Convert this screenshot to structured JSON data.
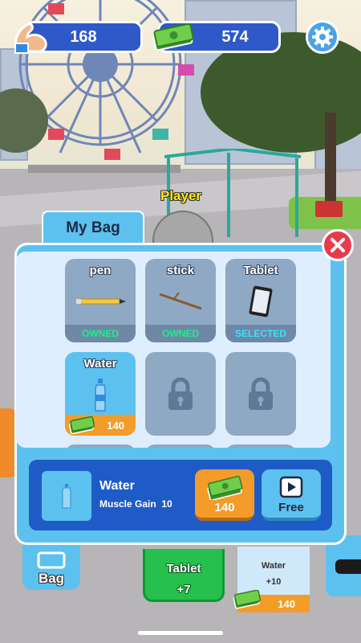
{
  "hud": {
    "strength_value": "168",
    "cash_value": "574",
    "strength_icon": "flexed-arm-icon",
    "cash_icon": "cash-stack-icon",
    "settings_icon": "gear-icon"
  },
  "player": {
    "name": "Player"
  },
  "bag": {
    "tab_label": "My Bag",
    "close_icon": "close-icon",
    "items": [
      {
        "name": "pen",
        "status": "OWNED",
        "status_color": "#18f08a",
        "icon": "pen-icon"
      },
      {
        "name": "stick",
        "status": "OWNED",
        "status_color": "#18f08a",
        "icon": "stick-icon"
      },
      {
        "name": "Tablet",
        "status": "SELECTED",
        "status_color": "#34e6ff",
        "icon": "tablet-icon"
      },
      {
        "name": "Water",
        "price": "140",
        "icon": "water-bottle-icon"
      },
      {
        "locked": true,
        "icon": "lock-icon"
      },
      {
        "locked": true,
        "icon": "lock-icon"
      }
    ]
  },
  "detail": {
    "name": "Water",
    "stat_label": "Muscle Gain",
    "stat_value": "10",
    "price": "140",
    "free_label": "Free"
  },
  "bottom": {
    "bag_label": "Bag",
    "tablet_name": "Tablet",
    "tablet_gain": "+7",
    "water_name": "Water",
    "water_gain": "+10",
    "water_price": "140"
  },
  "colors": {
    "accent_blue": "#2f59c8",
    "panel_blue": "#5dc1ef",
    "buy_orange": "#f39c2a",
    "close_red": "#e83a4c",
    "green_tile": "#26c04c"
  }
}
